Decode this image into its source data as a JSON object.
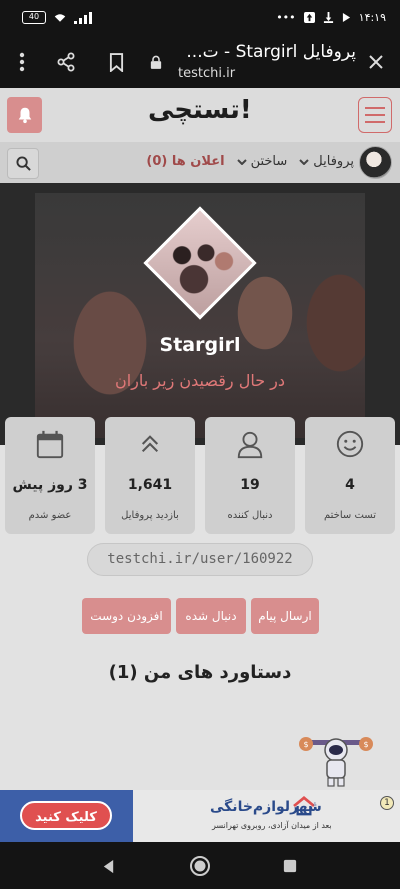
{
  "status_bar": {
    "time": "۱۴:۱۹",
    "battery": "40"
  },
  "browser": {
    "title": "پروفایل Stargirl - ت...",
    "url": "testchi.ir"
  },
  "site": {
    "logo": "تستچی!"
  },
  "nav": {
    "profile": "پروفایل",
    "build": "ساختن",
    "notifications": "اعلان ها (0)"
  },
  "profile": {
    "username": "Stargirl",
    "status": "در حال رقصیدن زیر باران"
  },
  "stats": [
    {
      "icon": "smiley-icon",
      "value": "4",
      "label": "تست ساختم"
    },
    {
      "icon": "user-icon",
      "value": "19",
      "label": "دنبال کننده"
    },
    {
      "icon": "chevrons-up-icon",
      "value": "1,641",
      "label": "بازدید پروفایل"
    },
    {
      "icon": "calendar-icon",
      "value": "3 روز پیش",
      "label": "عضو شدم"
    }
  ],
  "profile_url": "testchi.ir/user/160922",
  "actions": {
    "send_message": "ارسال پیام",
    "followed": "دنبال شده",
    "add_friend": "افزودن دوست"
  },
  "achievements_title": "دستاورد های من (1)",
  "ad": {
    "click_label": "کلیک کنید",
    "brand": "شهرلوازم‌خانگی",
    "brand_sub": "بعد از میدان آزادی، روبروی تهرانسر",
    "badge": "1"
  },
  "colors": {
    "accent": "#d88e8e",
    "status_text": "#e07878",
    "dark_bar": "#141414"
  }
}
